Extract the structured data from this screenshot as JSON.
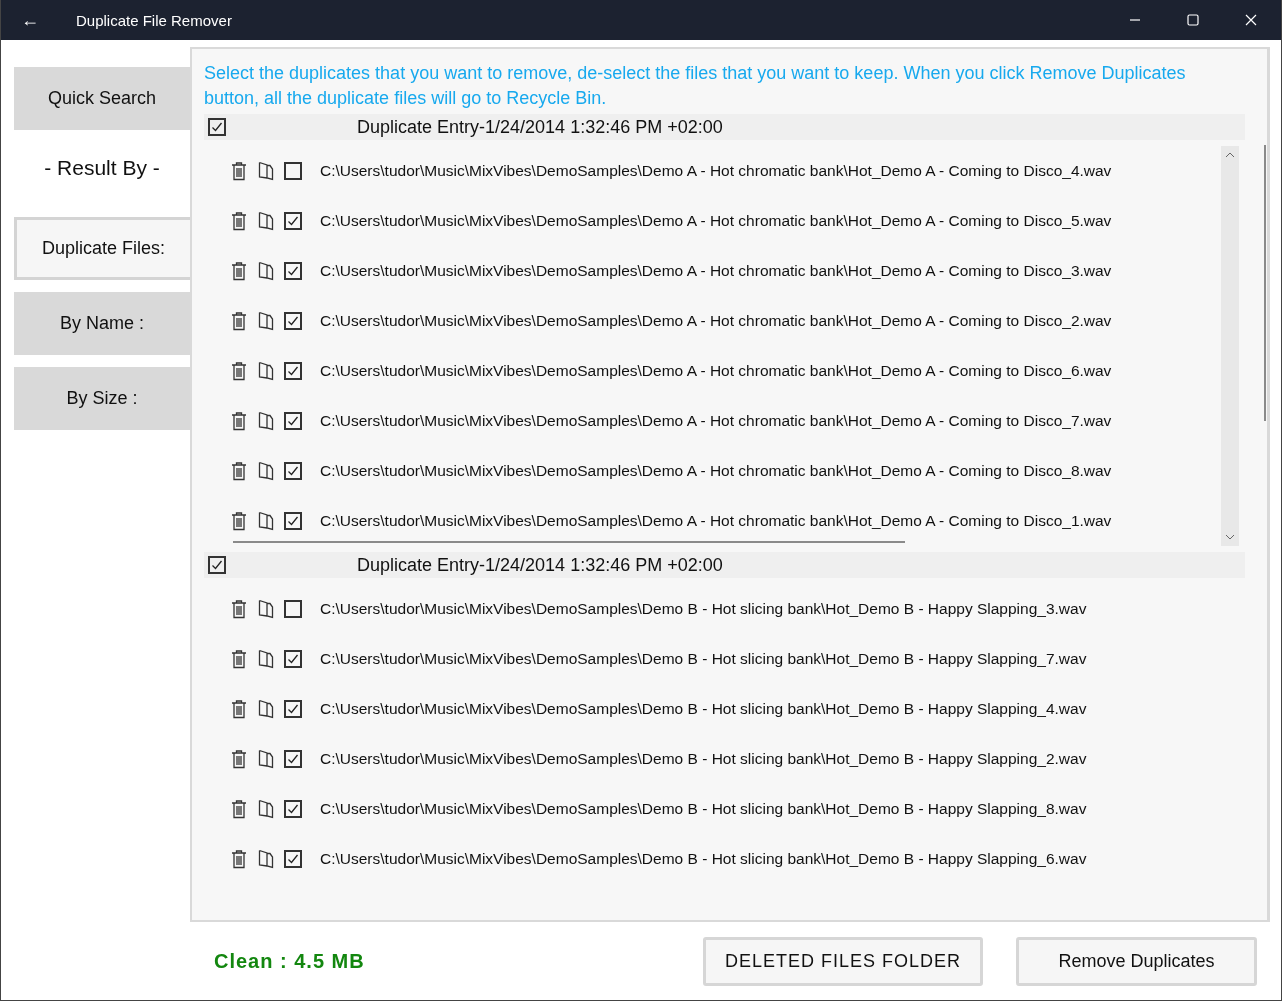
{
  "window": {
    "title": "Duplicate File Remover",
    "back": "←"
  },
  "sidebar": {
    "quick_search": "Quick Search",
    "result_by": "- Result By -",
    "options": [
      {
        "label": "Duplicate Files:",
        "selected": true
      },
      {
        "label": "By Name :",
        "selected": false
      },
      {
        "label": "By Size :",
        "selected": false
      }
    ]
  },
  "instruction": "Select the duplicates that you want to remove, de-select the files that you want to keep. When you click Remove Duplicates button, all the duplicate files will go to Recycle Bin.",
  "groups": [
    {
      "title": "Duplicate Entry-1/24/2014 1:32:46 PM +02:00",
      "checked": true,
      "scrollable": true,
      "files": [
        {
          "path": "C:\\Users\\tudor\\Music\\MixVibes\\DemoSamples\\Demo A - Hot chromatic bank\\Hot_Demo A - Coming to Disco_4.wav",
          "checked": false
        },
        {
          "path": "C:\\Users\\tudor\\Music\\MixVibes\\DemoSamples\\Demo A - Hot chromatic bank\\Hot_Demo A - Coming to Disco_5.wav",
          "checked": true
        },
        {
          "path": "C:\\Users\\tudor\\Music\\MixVibes\\DemoSamples\\Demo A - Hot chromatic bank\\Hot_Demo A - Coming to Disco_3.wav",
          "checked": true
        },
        {
          "path": "C:\\Users\\tudor\\Music\\MixVibes\\DemoSamples\\Demo A - Hot chromatic bank\\Hot_Demo A - Coming to Disco_2.wav",
          "checked": true
        },
        {
          "path": "C:\\Users\\tudor\\Music\\MixVibes\\DemoSamples\\Demo A - Hot chromatic bank\\Hot_Demo A - Coming to Disco_6.wav",
          "checked": true
        },
        {
          "path": "C:\\Users\\tudor\\Music\\MixVibes\\DemoSamples\\Demo A - Hot chromatic bank\\Hot_Demo A - Coming to Disco_7.wav",
          "checked": true
        },
        {
          "path": "C:\\Users\\tudor\\Music\\MixVibes\\DemoSamples\\Demo A - Hot chromatic bank\\Hot_Demo A - Coming to Disco_8.wav",
          "checked": true
        },
        {
          "path": "C:\\Users\\tudor\\Music\\MixVibes\\DemoSamples\\Demo A - Hot chromatic bank\\Hot_Demo A - Coming to Disco_1.wav",
          "checked": true
        }
      ]
    },
    {
      "title": "Duplicate Entry-1/24/2014 1:32:46 PM +02:00",
      "checked": true,
      "scrollable": false,
      "files": [
        {
          "path": "C:\\Users\\tudor\\Music\\MixVibes\\DemoSamples\\Demo B - Hot slicing bank\\Hot_Demo B - Happy Slapping_3.wav",
          "checked": false
        },
        {
          "path": "C:\\Users\\tudor\\Music\\MixVibes\\DemoSamples\\Demo B - Hot slicing bank\\Hot_Demo B - Happy Slapping_7.wav",
          "checked": true
        },
        {
          "path": "C:\\Users\\tudor\\Music\\MixVibes\\DemoSamples\\Demo B - Hot slicing bank\\Hot_Demo B - Happy Slapping_4.wav",
          "checked": true
        },
        {
          "path": "C:\\Users\\tudor\\Music\\MixVibes\\DemoSamples\\Demo B - Hot slicing bank\\Hot_Demo B - Happy Slapping_2.wav",
          "checked": true
        },
        {
          "path": "C:\\Users\\tudor\\Music\\MixVibes\\DemoSamples\\Demo B - Hot slicing bank\\Hot_Demo B - Happy Slapping_8.wav",
          "checked": true
        },
        {
          "path": "C:\\Users\\tudor\\Music\\MixVibes\\DemoSamples\\Demo B - Hot slicing bank\\Hot_Demo B - Happy Slapping_6.wav",
          "checked": true
        }
      ]
    }
  ],
  "clean": "Clean : 4.5 MB",
  "buttons": [
    "DELETED FILES FOLDER",
    "Remove Duplicates"
  ]
}
